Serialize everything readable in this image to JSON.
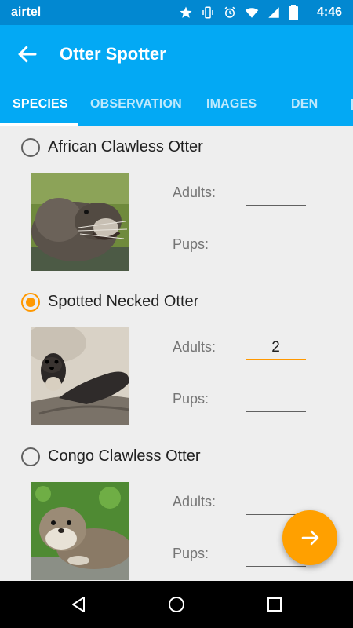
{
  "status_bar": {
    "carrier": "airtel",
    "time": "4:46"
  },
  "app_bar": {
    "title": "Otter Spotter",
    "tabs": [
      {
        "label": "SPECIES",
        "active": true
      },
      {
        "label": "OBSERVATION",
        "active": false
      },
      {
        "label": "IMAGES",
        "active": false
      },
      {
        "label": "DEN",
        "active": false
      }
    ]
  },
  "species": [
    {
      "name": "African Clawless Otter",
      "selected": false,
      "adults_label": "Adults:",
      "adults_value": "",
      "pups_label": "Pups:",
      "pups_value": ""
    },
    {
      "name": "Spotted Necked Otter",
      "selected": true,
      "adults_label": "Adults:",
      "adults_value": "2",
      "pups_label": "Pups:",
      "pups_value": ""
    },
    {
      "name": "Congo Clawless Otter",
      "selected": false,
      "adults_label": "Adults:",
      "adults_value": "",
      "pups_label": "Pups:",
      "pups_value": ""
    }
  ],
  "colors": {
    "primary": "#03a9f4",
    "primary_dark": "#0288d1",
    "accent": "#ff9800",
    "fab": "#ffa000"
  }
}
